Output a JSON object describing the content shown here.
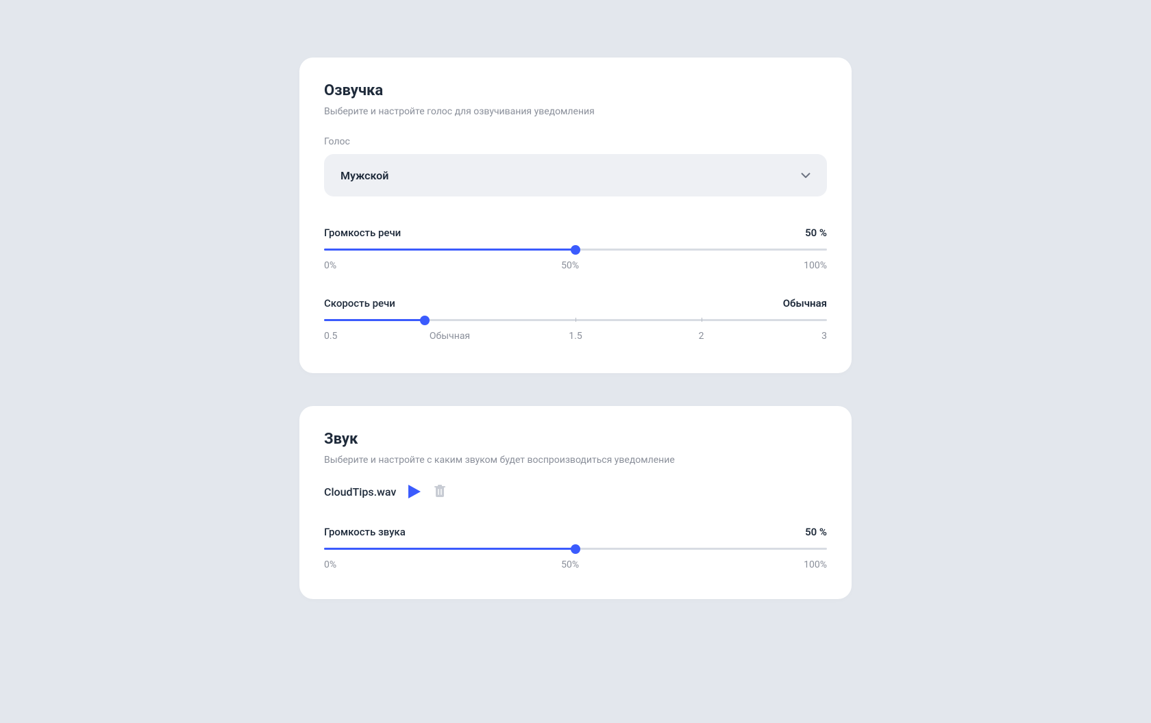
{
  "voiceover": {
    "title": "Озвучка",
    "subtitle": "Выберите и настройте голос для озвучивания уведомления",
    "voice_label": "Голос",
    "voice_value": "Мужской",
    "volume": {
      "label": "Громкость речи",
      "value": "50 %",
      "percent": 50,
      "min_label": "0%",
      "mid_label": "50%",
      "max_label": "100%"
    },
    "speed": {
      "label": "Скорость речи",
      "value": "Обычная",
      "percent": 20,
      "ticks": [
        "0.5",
        "Обычная",
        "1.5",
        "2",
        "3"
      ]
    }
  },
  "sound": {
    "title": "Звук",
    "subtitle": "Выберите и настройте с каким звуком будет воспроизводиться уведомление",
    "file_name": "CloudTips.wav",
    "volume": {
      "label": "Громкость звука",
      "value": "50 %",
      "percent": 50,
      "min_label": "0%",
      "mid_label": "50%",
      "max_label": "100%"
    }
  },
  "colors": {
    "accent": "#3b5bfd",
    "text_primary": "#1e2a3a",
    "text_secondary": "#8a8f9a",
    "bg_page": "#e3e7ed",
    "bg_card": "#ffffff",
    "bg_select": "#eef0f4"
  }
}
